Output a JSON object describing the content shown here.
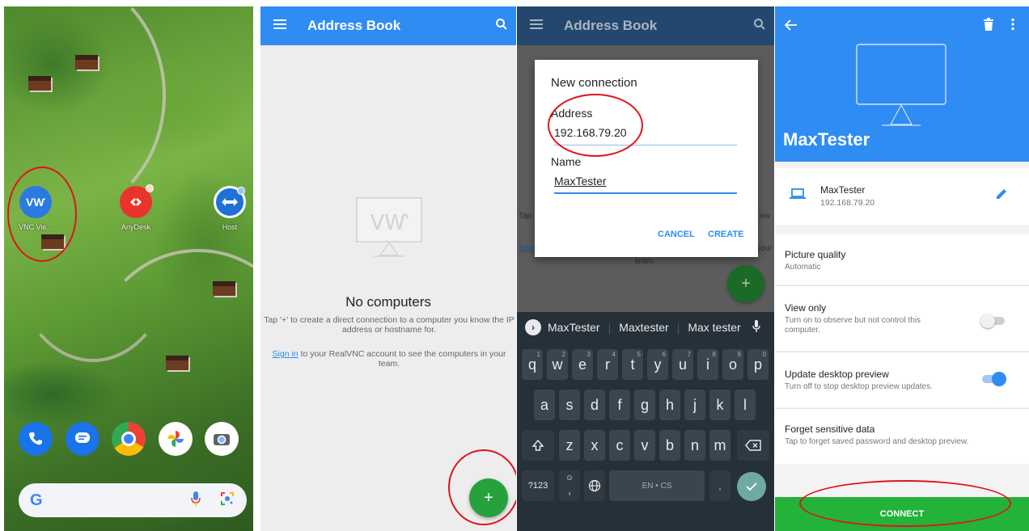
{
  "home": {
    "apps": [
      {
        "label": "VNC Vie...",
        "icon": "vnc-viewer-icon",
        "color": "#2a7ae2"
      },
      {
        "label": "AnyDesk",
        "icon": "anydesk-icon",
        "color": "#e8342c"
      },
      {
        "label": "Host",
        "icon": "teamviewer-host-icon",
        "color": "#1f71d8"
      }
    ],
    "dock": [
      "phone-icon",
      "messages-icon",
      "chrome-icon",
      "photos-icon",
      "camera-icon"
    ],
    "search_logo": "G"
  },
  "address_book": {
    "title": "Address Book",
    "empty_title": "No computers",
    "empty_text": "Tap '+' to create a direct connection to a computer you know the IP address or hostname for.",
    "sign_in_link": "Sign in",
    "sign_in_text": " to your RealVNC account to see the computers in your team.",
    "fab": "+"
  },
  "new_connection": {
    "title": "New connection",
    "address_label": "Address",
    "address_value": "192.168.79.20",
    "name_label": "Name",
    "name_value": "MaxTester",
    "cancel": "CANCEL",
    "create": "CREATE",
    "bg_title": "Address Book",
    "bg_text_left": "Tap",
    "bg_text_right": "ow",
    "bg_sign": "Sign",
    "bg_your": "your",
    "bg_team": "team.",
    "suggestions": [
      "MaxTester",
      "Maxtester",
      "Max tester"
    ],
    "keyboard": {
      "row1": [
        "q",
        "w",
        "e",
        "r",
        "t",
        "y",
        "u",
        "i",
        "o",
        "p"
      ],
      "row1_nums": [
        "1",
        "2",
        "3",
        "4",
        "5",
        "6",
        "7",
        "8",
        "9",
        "0"
      ],
      "row2": [
        "a",
        "s",
        "d",
        "f",
        "g",
        "h",
        "j",
        "k",
        "l"
      ],
      "row3": [
        "z",
        "x",
        "c",
        "v",
        "b",
        "n",
        "m"
      ],
      "sym": "?123",
      "comma": ",",
      "space": "EN • CS",
      "period": "."
    }
  },
  "details": {
    "computer_name": "MaxTester",
    "entry_name": "MaxTester",
    "entry_address": "192.168.79.20",
    "picture_quality": "Picture quality",
    "picture_quality_value": "Automatic",
    "view_only": "View only",
    "view_only_sub": "Turn on to observe but not control this computer.",
    "view_only_on": false,
    "update_preview": "Update desktop preview",
    "update_preview_sub": "Turn off to stop desktop preview updates.",
    "update_preview_on": true,
    "forget": "Forget sensitive data",
    "forget_sub": "Tap to forget saved password and desktop preview.",
    "connect": "CONNECT"
  },
  "colors": {
    "accent": "#2f8cf2",
    "fab": "#27a13b",
    "connect": "#23b23a",
    "annotation": "#e0141e"
  }
}
